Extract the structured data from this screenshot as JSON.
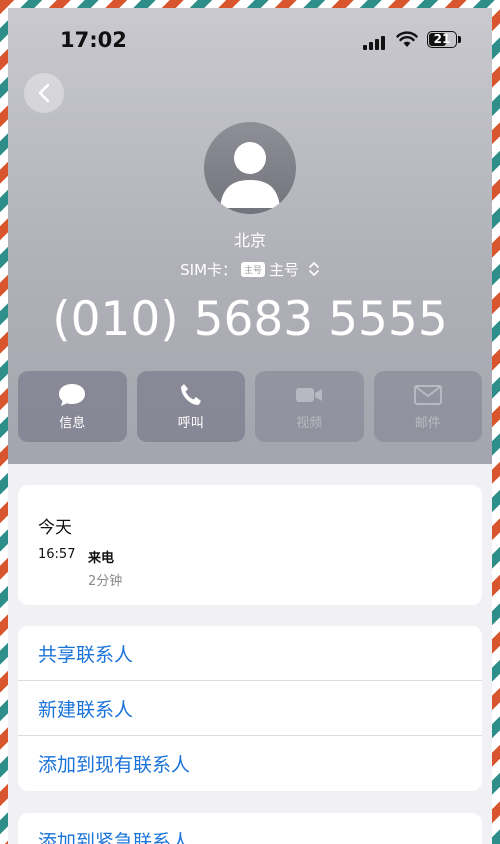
{
  "status_bar": {
    "time": "17:02",
    "battery": "21"
  },
  "contact": {
    "location": "北京",
    "sim_label": "SIM卡：",
    "sim_badge": "主号",
    "sim_line": "主号",
    "phone_number": "(010) 5683 5555"
  },
  "actions": [
    {
      "label": "信息",
      "icon": "message-icon",
      "enabled": true
    },
    {
      "label": "呼叫",
      "icon": "phone-icon",
      "enabled": true
    },
    {
      "label": "视频",
      "icon": "video-icon",
      "enabled": false
    },
    {
      "label": "邮件",
      "icon": "mail-icon",
      "enabled": false
    }
  ],
  "recents": {
    "day": "今天",
    "time": "16:57",
    "type": "来电",
    "duration": "2分钟"
  },
  "options": [
    {
      "label": "共享联系人"
    },
    {
      "label": "新建联系人"
    },
    {
      "label": "添加到现有联系人"
    }
  ],
  "options2": [
    {
      "label": "添加到紧急联系人"
    }
  ],
  "colors": {
    "link_blue": "#1a73d9",
    "stripe_red": "#d8552e",
    "stripe_teal": "#2e8f8a"
  }
}
